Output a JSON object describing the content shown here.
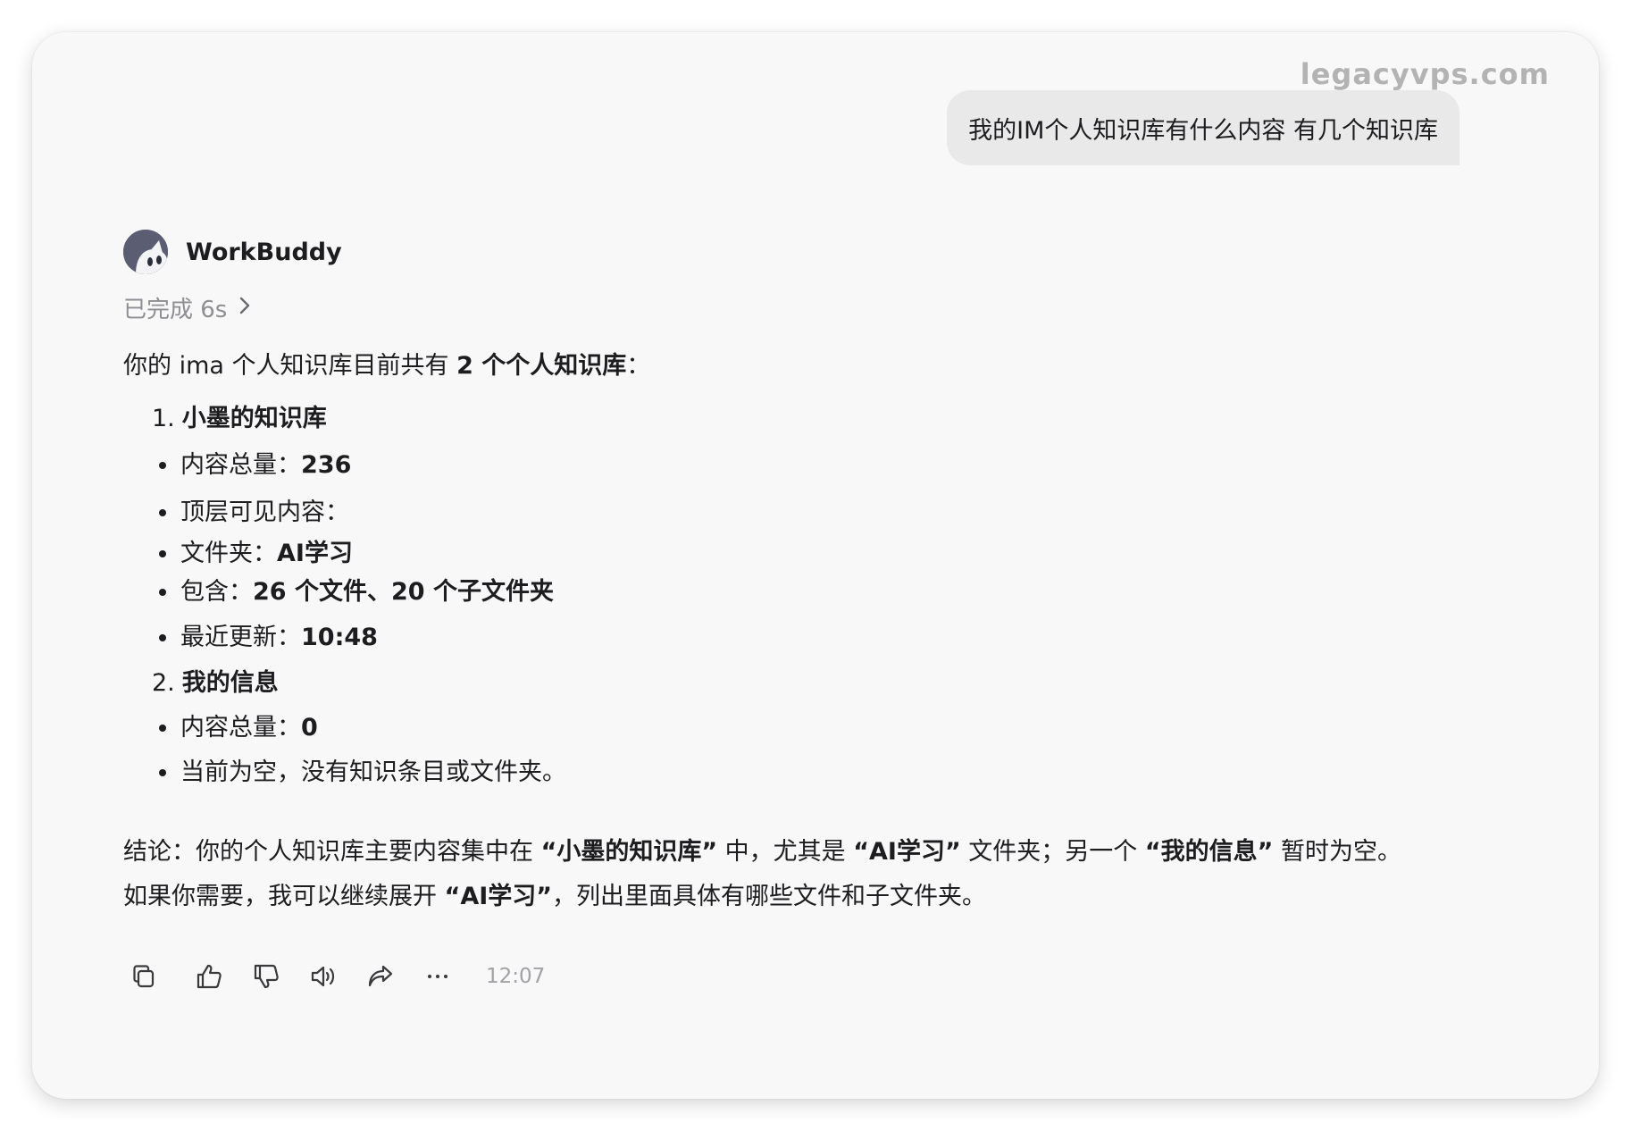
{
  "watermark": "legacyvps.com",
  "user_message": "我的IM个人知识库有什么内容 有几个知识库",
  "assistant": {
    "name": "WorkBuddy",
    "status": "已完成 6s",
    "intro": {
      "pre": "你的 ima 个人知识库目前共有 ",
      "bold": "2 个个人知识库",
      "post": "："
    },
    "kb1": {
      "num": "1.",
      "title": "小墨的知识库",
      "total_label": "内容总量：",
      "total_value": "236",
      "top_label": "顶层可见内容：",
      "folder_label": "文件夹：",
      "folder_value": "AI学习",
      "contains_label": "包含：",
      "contains_value": "26 个文件、20 个子文件夹",
      "updated_label": "最近更新：",
      "updated_value": "10:48"
    },
    "kb2": {
      "num": "2.",
      "title": "我的信息",
      "total_label": "内容总量：",
      "total_value": "0",
      "note": "当前为空，没有知识条目或文件夹。"
    },
    "conclusion": {
      "p1_a": "结论：你的个人知识库主要内容集中在 ",
      "p1_b": "“小墨的知识库”",
      "p1_c": " 中，尤其是 ",
      "p1_d": "“AI学习”",
      "p1_e": " 文件夹；另一个 ",
      "p1_f": "“我的信息”",
      "p1_g": " 暂时为空。",
      "p2_a": "如果你需要，我可以继续展开 ",
      "p2_b": "“AI学习”",
      "p2_c": "，列出里面具体有哪些文件和子文件夹。"
    },
    "actions": [
      "copy-icon",
      "thumbs-up-icon",
      "thumbs-down-icon",
      "speaker-icon",
      "share-icon",
      "more-icon"
    ],
    "timestamp": "12:07"
  }
}
